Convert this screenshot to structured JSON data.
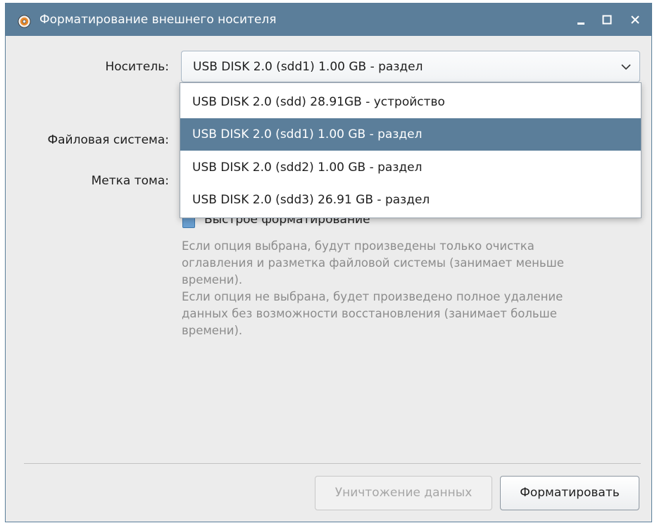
{
  "window": {
    "title": "Форматирование внешнего носителя",
    "icon": "disk-utility-icon",
    "controls": {
      "minimize": "minimize-icon",
      "maximize": "maximize-icon",
      "close": "close-icon"
    },
    "accent_color": "#5b7e9a"
  },
  "form": {
    "device_label": "Носитель:",
    "filesystem_label": "Файловая система:",
    "volume_label": "Метка тома:",
    "device_selected": "USB DISK 2.0 (sdd1) 1.00 GB - раздел"
  },
  "dropdown": {
    "items": [
      {
        "label": "USB DISK 2.0 (sdd) 28.91GB - устройство",
        "selected": false
      },
      {
        "label": "USB DISK 2.0 (sdd1) 1.00 GB - раздел",
        "selected": true
      },
      {
        "label": "USB DISK 2.0 (sdd2) 1.00 GB - раздел",
        "selected": false
      },
      {
        "label": "USB DISK 2.0 (sdd3) 26.91 GB - раздел",
        "selected": false
      }
    ]
  },
  "quick_format": {
    "label": "Быстрое форматирование",
    "checked": true,
    "help_lines": [
      "Если опция выбрана, будут произведены только очистка",
      "оглавления и разметка файловой системы (занимает меньше",
      "времени).",
      "Если опция не выбрана, будет произведено полное удаление",
      "данных без возможности восстановления (занимает больше",
      "времени)."
    ]
  },
  "buttons": {
    "wipe": "Уничтожение данных",
    "wipe_enabled": false,
    "format": "Форматировать"
  }
}
